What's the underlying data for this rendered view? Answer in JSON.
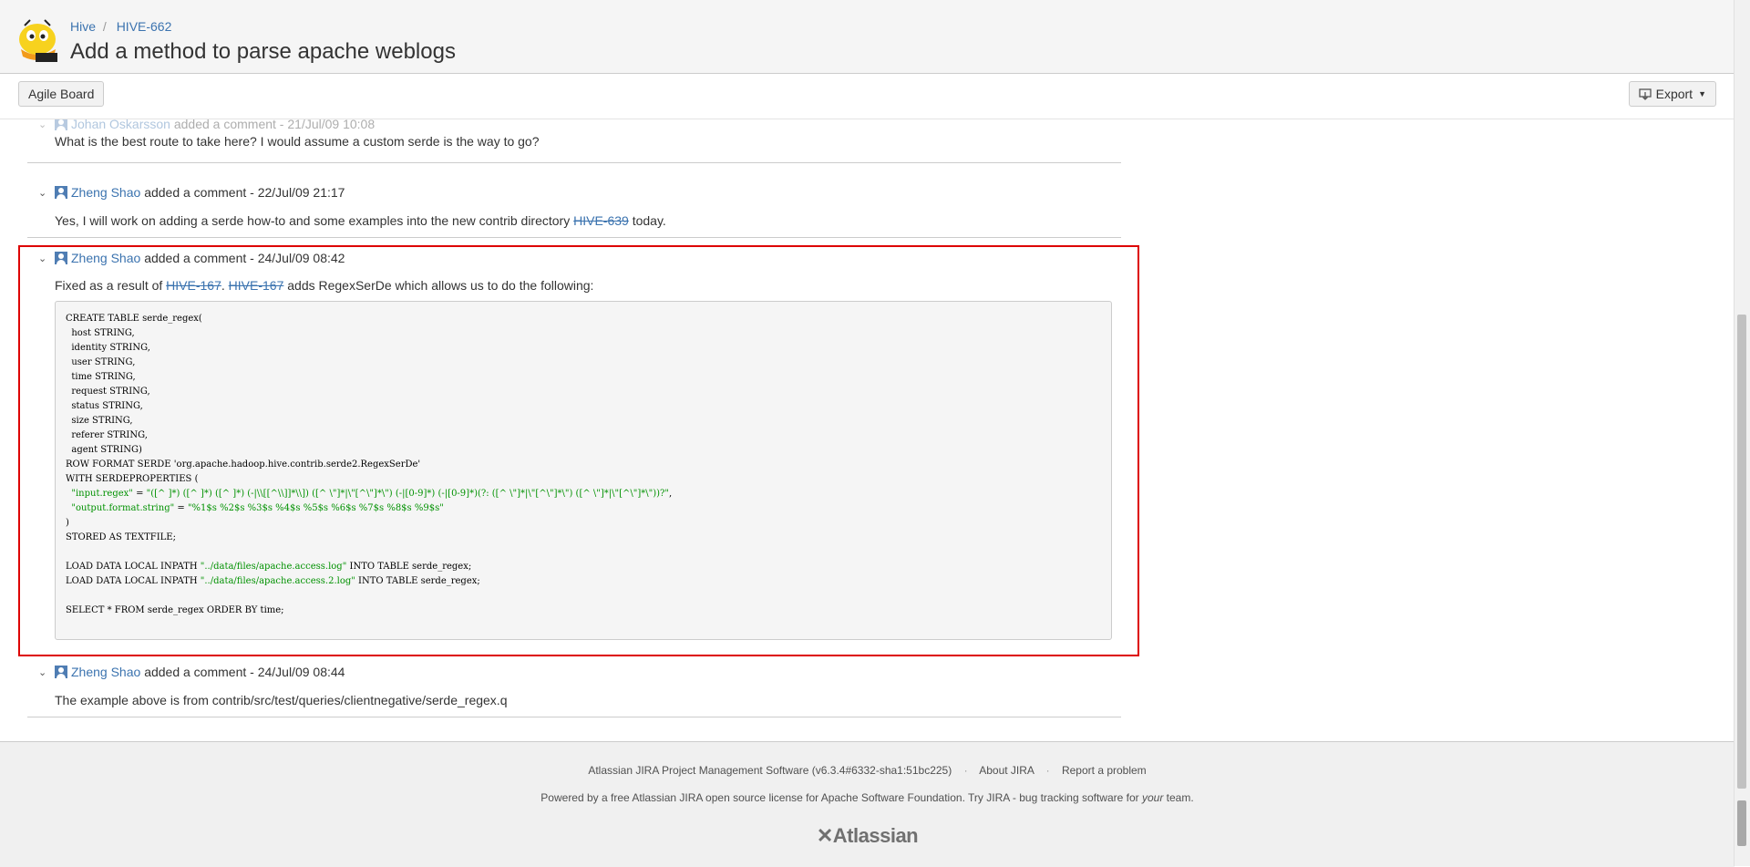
{
  "breadcrumb": {
    "project": "Hive",
    "separator": "/",
    "issue_key": "HIVE-662"
  },
  "page_title": "Add a method to parse apache weblogs",
  "toolbar": {
    "agile_board": "Agile Board",
    "export": "Export",
    "export_icon": "export-icon"
  },
  "comments": [
    {
      "author": "Johan Oskarsson",
      "action": "added a comment -",
      "date": "21/Jul/09 10:08",
      "text": "What is the best route to take here? I would assume a custom serde is the way to go?"
    },
    {
      "author": "Zheng Shao",
      "action": "added a comment -",
      "date": "22/Jul/09 21:17",
      "text_before": "Yes, I will work on adding a serde how-to and some examples into the new contrib directory ",
      "link": "HIVE-639",
      "text_after": " today."
    },
    {
      "author": "Zheng Shao",
      "action": "added a comment -",
      "date": "24/Jul/09 08:42",
      "text_before": "Fixed as a result of ",
      "link1": "HIVE-167",
      "between": ". ",
      "link2": "HIVE-167",
      "text_after": " adds RegexSerDe which allows us to do the following:",
      "code": {
        "l01": "CREATE TABLE serde_regex(",
        "l02": "  host STRING,",
        "l03": "  identity STRING,",
        "l04": "  user STRING,",
        "l05": "  time STRING,",
        "l06": "  request STRING,",
        "l07": "  status STRING,",
        "l08": "  size STRING,",
        "l09": "  referer STRING,",
        "l10": "  agent STRING)",
        "l11_a": "ROW FORMAT SERDE ",
        "l11_b": "'org.apache.hadoop.hive.contrib.serde2.RegexSerDe'",
        "l12": "WITH SERDEPROPERTIES (",
        "l13_a": "  \"input.regex\"",
        "l13_b": " = ",
        "l13_c": "\"([^ ]*) ([^ ]*) ([^ ]*) (-|\\\\[[^\\\\]]*\\\\]) ([^ \\\"]*|\\\"[^\\\"]*\\\") (-|[0-9]*) (-|[0-9]*)(?: ([^ \\\"]*|\\\"[^\\\"]*\\\") ([^ \\\"]*|\\\"[^\\\"]*\\\"))?\"",
        "l13_d": ",",
        "l14_a": "  \"output.format.string\"",
        "l14_b": " = ",
        "l14_c": "\"%1$s %2$s %3$s %4$s %5$s %6$s %7$s %8$s %9$s\"",
        "l15": ")",
        "l16": "STORED AS TEXTFILE;",
        "l17": "",
        "l18_a": "LOAD DATA LOCAL INPATH ",
        "l18_b": "\"../data/files/apache.access.log\"",
        "l18_c": " INTO TABLE serde_regex;",
        "l19_a": "LOAD DATA LOCAL INPATH ",
        "l19_b": "\"../data/files/apache.access.2.log\"",
        "l19_c": " INTO TABLE serde_regex;",
        "l20": "",
        "l21": "SELECT * FROM serde_regex ORDER BY time;"
      }
    },
    {
      "author": "Zheng Shao",
      "action": "added a comment -",
      "date": "24/Jul/09 08:44",
      "text": "The example above is from contrib/src/test/queries/clientnegative/serde_regex.q"
    }
  ],
  "footer": {
    "software": "Atlassian JIRA Project Management Software (v6.3.4#6332-sha1:51bc225)",
    "about": "About JIRA",
    "report": "Report a problem",
    "powered_before": "Powered by a free Atlassian JIRA open source license for Apache Software Foundation. Try JIRA - bug tracking software for ",
    "powered_em": "your",
    "powered_after": " team.",
    "brand": "Atlassian"
  },
  "colors": {
    "link": "#3b73af",
    "highlight_border": "#dd0000",
    "code_string": "#009100"
  }
}
